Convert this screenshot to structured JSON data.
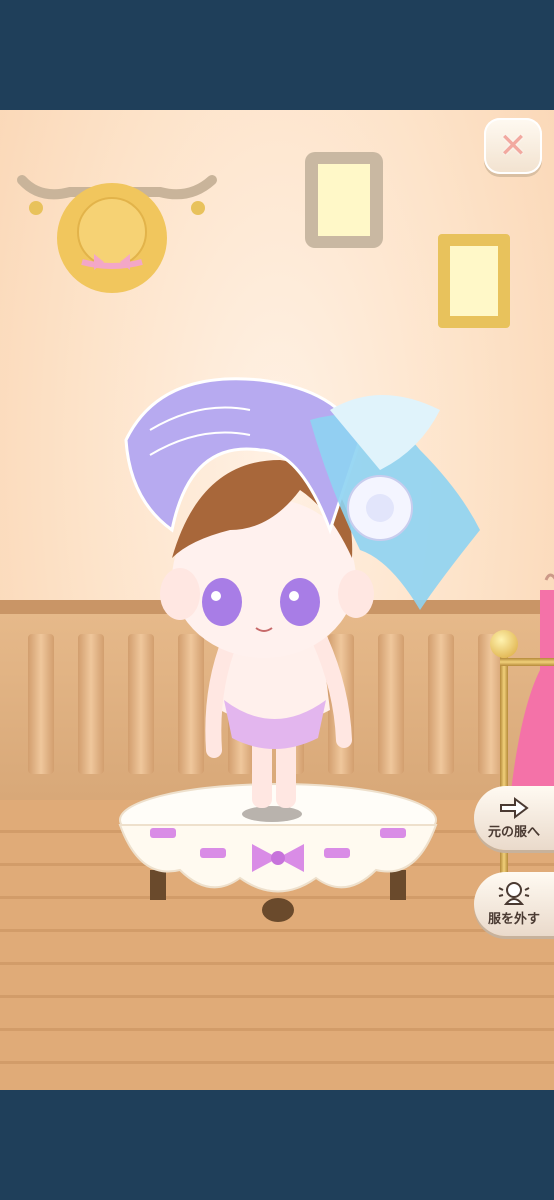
{
  "buttons": {
    "close_glyph": "✕",
    "restore_label": "元の服へ",
    "remove_label": "服を外す"
  },
  "colors": {
    "frame_bar": "#1f3f5a",
    "wall": "#fde3c9",
    "wainscot": "#d8a878",
    "floor": "#e0ab78",
    "bonnet": "#b7aaf0",
    "ribbon": "#8ed3f2",
    "bow_accent": "#d98ce6"
  },
  "icons": [
    "close-icon",
    "arrow-right-icon",
    "character-silhouette-icon"
  ]
}
